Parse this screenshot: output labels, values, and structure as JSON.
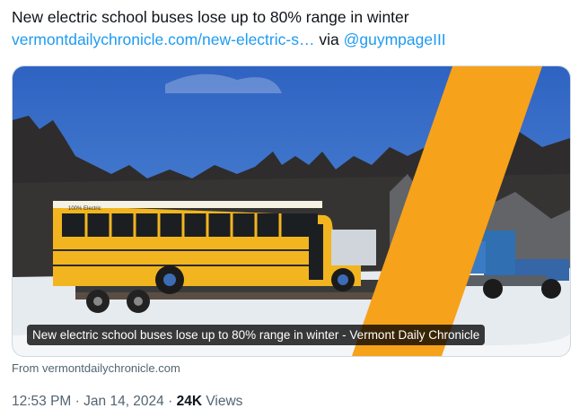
{
  "tweet": {
    "text": "New electric school buses lose up to 80% range in winter",
    "link_text": "vermontdailychronicle.com/new-electric-s…",
    "via": "via",
    "handle": "@guympageIII"
  },
  "card": {
    "caption": "New electric school buses lose up to 80% range in winter - Vermont Daily Chronicle",
    "bus_sign": "100% Electric",
    "from": "From vermontdailychronicle.com"
  },
  "meta": {
    "time": "12:53 PM",
    "separator": "·",
    "date": "Jan 14, 2024",
    "views_count": "24K",
    "views_label": "Views"
  },
  "colors": {
    "link": "#1d9bf0",
    "overlay_stripe": "#f7a21b",
    "bus_yellow": "#f2b51f"
  }
}
